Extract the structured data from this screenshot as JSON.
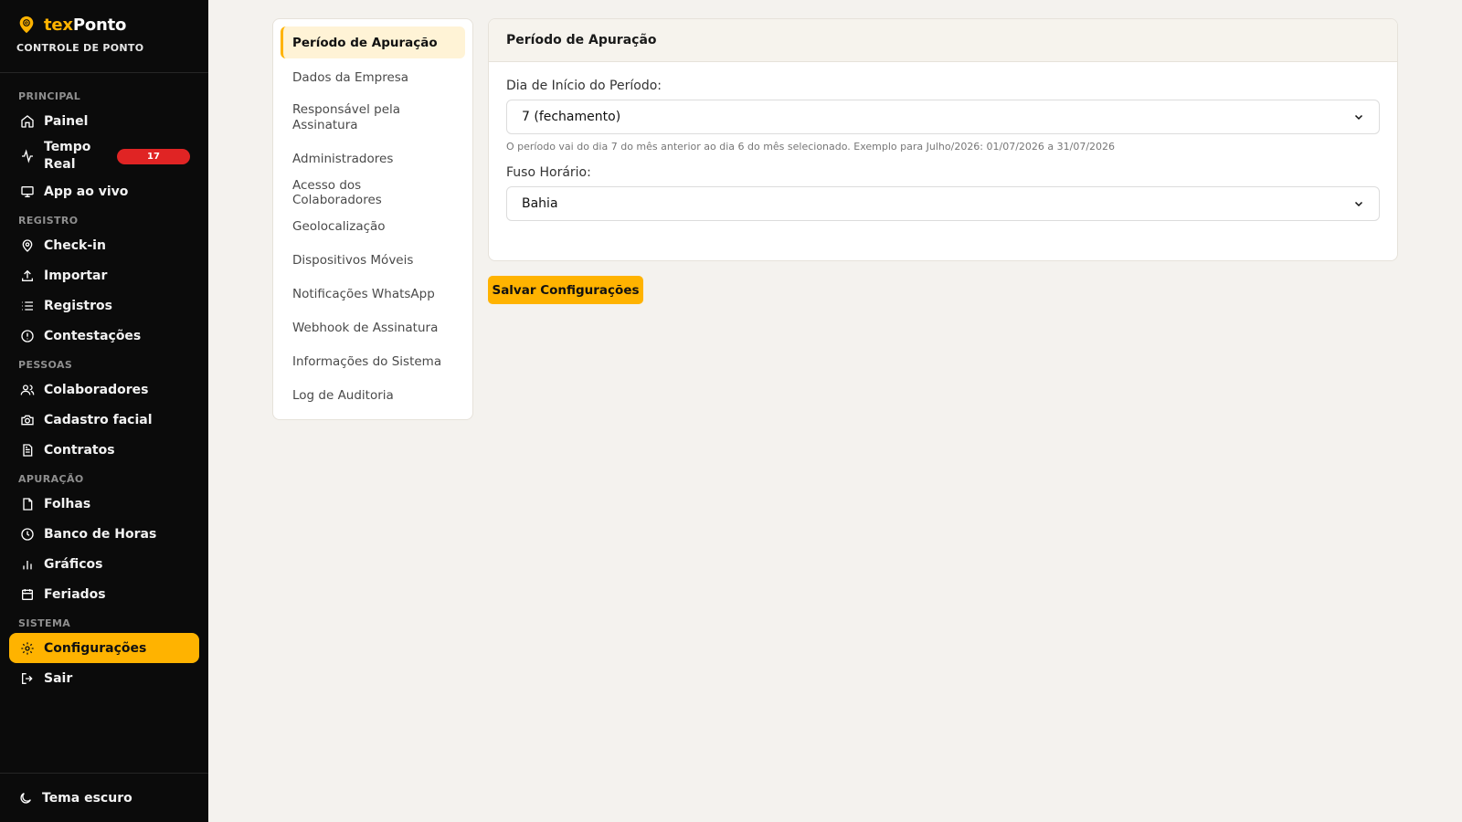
{
  "brand": {
    "name_prefix": "tex",
    "name_suffix": "Ponto",
    "subtitle": "CONTROLE DE PONTO",
    "accent_color": "#ffb300"
  },
  "sidebar": {
    "sections": [
      {
        "title": "PRINCIPAL",
        "items": [
          {
            "label": "Painel",
            "icon": "home-icon"
          },
          {
            "label": "Tempo Real",
            "icon": "activity-icon",
            "badge": "17"
          },
          {
            "label": "App ao vivo",
            "icon": "monitor-icon"
          }
        ]
      },
      {
        "title": "REGISTRO",
        "items": [
          {
            "label": "Check-in",
            "icon": "map-pin-icon"
          },
          {
            "label": "Importar",
            "icon": "upload-icon"
          },
          {
            "label": "Registros",
            "icon": "list-icon"
          },
          {
            "label": "Contestações",
            "icon": "alert-circle-icon"
          }
        ]
      },
      {
        "title": "PESSOAS",
        "items": [
          {
            "label": "Colaboradores",
            "icon": "users-icon"
          },
          {
            "label": "Cadastro facial",
            "icon": "camera-icon"
          },
          {
            "label": "Contratos",
            "icon": "file-text-icon"
          }
        ]
      },
      {
        "title": "APURAÇÃO",
        "items": [
          {
            "label": "Folhas",
            "icon": "file-icon"
          },
          {
            "label": "Banco de Horas",
            "icon": "clock-icon"
          },
          {
            "label": "Gráficos",
            "icon": "bar-chart-icon"
          },
          {
            "label": "Feriados",
            "icon": "calendar-icon"
          }
        ]
      },
      {
        "title": "SISTEMA",
        "items": [
          {
            "label": "Configurações",
            "icon": "gear-icon",
            "active": true
          },
          {
            "label": "Sair",
            "icon": "logout-icon"
          }
        ]
      }
    ],
    "footer": {
      "label": "Tema escuro",
      "icon": "moon-icon"
    }
  },
  "settings_menu": {
    "items": [
      {
        "label": "Período de Apuração",
        "active": true
      },
      {
        "label": "Dados da Empresa"
      },
      {
        "label": "Responsável pela Assinatura"
      },
      {
        "label": "Administradores"
      },
      {
        "label": "Acesso dos Colaboradores"
      },
      {
        "label": "Geolocalização"
      },
      {
        "label": "Dispositivos Móveis"
      },
      {
        "label": "Notificações WhatsApp"
      },
      {
        "label": "Webhook de Assinatura"
      },
      {
        "label": "Informações do Sistema"
      },
      {
        "label": "Log de Auditoria"
      }
    ]
  },
  "card": {
    "title": "Período de Apuração",
    "start_day": {
      "label": "Dia de Início do Período:",
      "value": "7 (fechamento)",
      "hint": "O período vai do dia 7 do mês anterior ao dia 6 do mês selecionado. Exemplo para Julho/2026: 01/07/2026 a 31/07/2026"
    },
    "timezone": {
      "label": "Fuso Horário:",
      "value": "Bahia"
    }
  },
  "save_button": {
    "label": "Salvar Configurações"
  }
}
